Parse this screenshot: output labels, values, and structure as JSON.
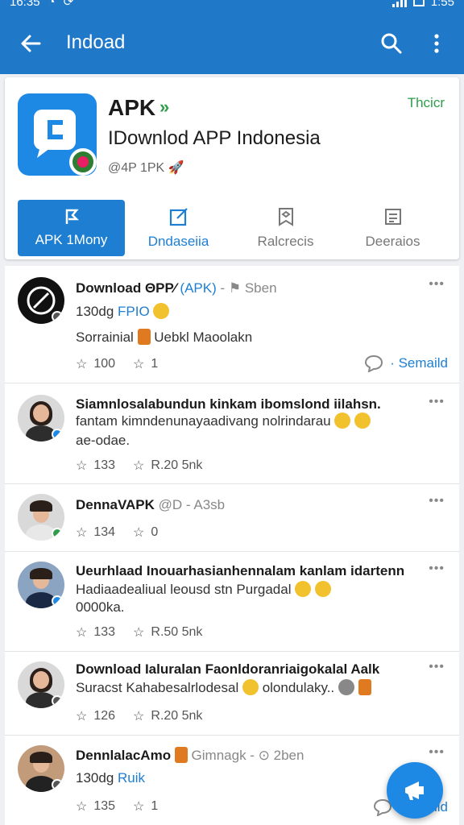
{
  "status_bar": {
    "time_left": "16:35",
    "time_right": "1:55"
  },
  "app_bar": {
    "title": "Indoad"
  },
  "header": {
    "app_name": "APK",
    "follow_label": "Thcicr",
    "subtitle": "IDownlod APP Indonesia",
    "handle": "@4P 1PK",
    "tabs": [
      {
        "label": "APK 1Mony",
        "icon": "bookmark-flag-icon"
      },
      {
        "label": "Dndaseiia",
        "icon": "edit-square-icon"
      },
      {
        "label": "Ralcrecis",
        "icon": "badge-icon"
      },
      {
        "label": "Deeraios",
        "icon": "document-stack-icon"
      }
    ]
  },
  "posts": [
    {
      "title": "Download ΘPP⁄ ",
      "title_tag": "(APK)",
      "title_meta": " - ⚑ Sben",
      "line1": "130dg ",
      "line1_tag": "FPIO",
      "line2": "Sorrainial ",
      "line2_after": " Uebkl Maoolakn",
      "stat1": "100",
      "stat2": "1",
      "action": "Semaild"
    },
    {
      "title": "Siamnlosalabundun kinkam ibomslond iilahsn.",
      "line1": "fantam kimndenunayaadivang nolrindarau",
      "line2": "ae-odae.",
      "stat1": "133",
      "stat2": "R.20 5nk"
    },
    {
      "title": "DennaVAPK ",
      "title_meta": "@D - A3sb",
      "stat1": "134",
      "stat2": "0"
    },
    {
      "title": "Ueurhlaad Inouarhasianhennalam kanlam idartenn",
      "line1": "Hadiaadealiual leousd stn Purgadal",
      "line2": "0000ka.",
      "stat1": "133",
      "stat2": "R.50 5nk"
    },
    {
      "title": "Download Ialuralan Faonldoranriaigokalal Aalk",
      "line1": "Suracst Kahabesalrlodesal",
      "line1_after": " olondulaky..",
      "stat1": "126",
      "stat2": "R.20 5nk"
    },
    {
      "title": "DennlalacAmo ",
      "title_meta": "Gimnagk - ⊙ 2ben",
      "line1": "130dg ",
      "line1_tag": "Ruik",
      "stat1": "135",
      "stat2": "1",
      "action": "Semaild"
    }
  ],
  "colors": {
    "primary": "#1f78c8",
    "accent_green": "#2e9d4b"
  }
}
